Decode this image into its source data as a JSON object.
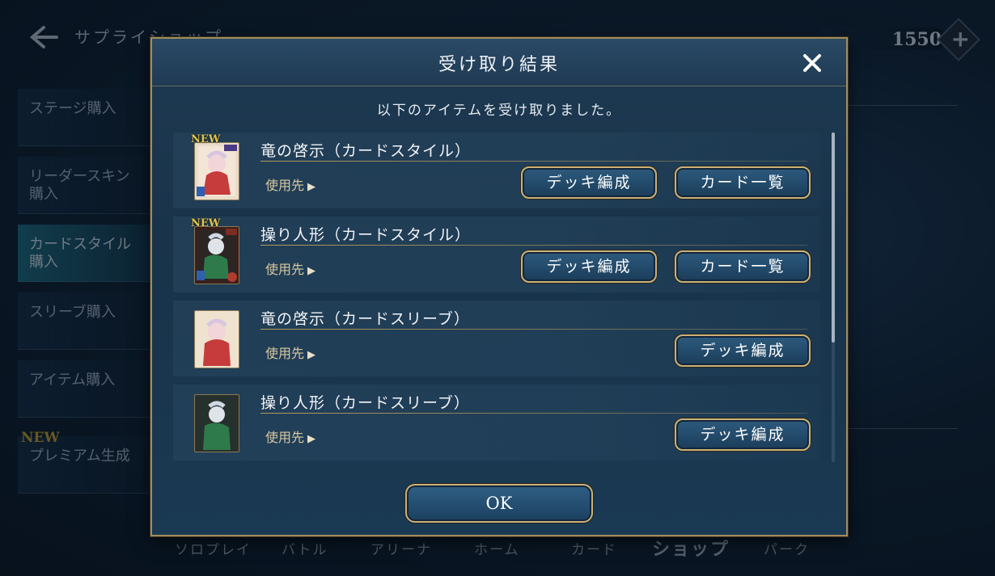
{
  "background": {
    "shop_title": "サプライショップ",
    "currency_value": "1550",
    "currency_plus": "+",
    "side_menu": [
      {
        "label": "ステージ購入"
      },
      {
        "label": "リーダースキン\n購入"
      },
      {
        "label": "カードスタイル\n購入"
      },
      {
        "label": "スリーブ購入"
      },
      {
        "label": "アイテム購入"
      },
      {
        "label": "プレミアム生成"
      }
    ],
    "side_new_badge": "NEW",
    "bottom_nav": [
      "ソロプレイ",
      "バトル",
      "アリーナ",
      "ホーム",
      "カード",
      "ショップ",
      "パーク"
    ]
  },
  "dialog": {
    "title": "受け取り結果",
    "message": "以下のアイテムを受け取りました。",
    "ok_label": "OK",
    "items": [
      {
        "name": "竜の啓示（カードスタイル）",
        "use_label": "使用先",
        "new": "NEW",
        "deck_label": "デッキ編成",
        "cards_label": "カード一覧"
      },
      {
        "name": "操り人形（カードスタイル）",
        "use_label": "使用先",
        "new": "NEW",
        "deck_label": "デッキ編成",
        "cards_label": "カード一覧"
      },
      {
        "name": "竜の啓示（カードスリーブ）",
        "use_label": "使用先",
        "deck_label": "デッキ編成"
      },
      {
        "name": "操り人形（カードスリーブ）",
        "use_label": "使用先",
        "deck_label": "デッキ編成"
      }
    ]
  },
  "colors": {
    "gold_border": "#a38d5c",
    "button_blue": "#2d5a7e",
    "new_badge": "#e5c54a"
  }
}
